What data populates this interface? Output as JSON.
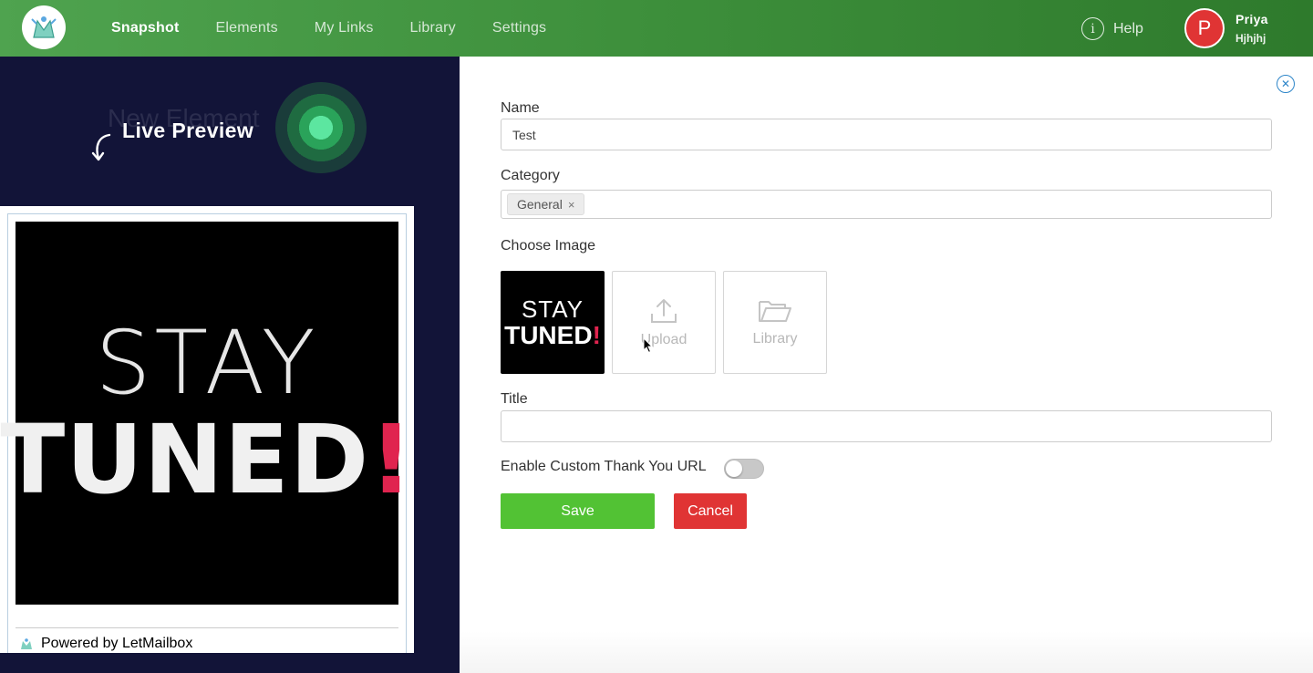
{
  "nav": {
    "links": [
      "Snapshot",
      "Elements",
      "My Links",
      "Library",
      "Settings"
    ],
    "help_label": "Help",
    "help_icon": "i",
    "user": {
      "initial": "P",
      "name": "Priya",
      "subtitle": "Hjhjhj"
    }
  },
  "preview": {
    "ghost_title": "New Element",
    "live_label": "Live Preview",
    "image_text_line1": "STAY",
    "image_text_line2": "TUNED",
    "image_text_exclaim": "!",
    "powered_by": "Powered by LetMailbox"
  },
  "form": {
    "close_icon": "✕",
    "name_label": "Name",
    "name_value": "Test",
    "category_label": "Category",
    "category_tag": "General",
    "category_tag_remove": "×",
    "image_label": "Choose Image",
    "thumb_line1": "STAY",
    "thumb_line2": "TUNED",
    "thumb_exclaim": "!",
    "upload_label": "Upload",
    "library_label": "Library",
    "title_label": "Title",
    "title_value": "",
    "thank_you_label": "Enable Custom Thank You URL",
    "thank_you_enabled": false,
    "save_label": "Save",
    "cancel_label": "Cancel"
  },
  "colors": {
    "nav_green": "#3d8f3b",
    "left_bg": "#121438",
    "save": "#52c234",
    "cancel": "#e03434",
    "accent_blue": "#2e86c9",
    "exclaim_red": "#e0244f"
  }
}
